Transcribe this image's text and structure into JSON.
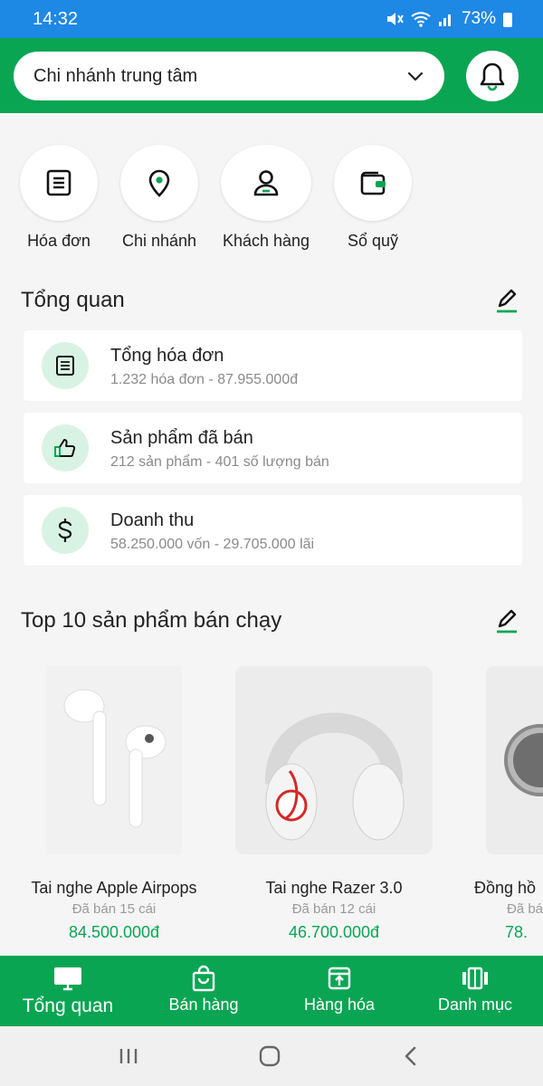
{
  "status_bar": {
    "time": "14:32",
    "battery": "73%"
  },
  "header": {
    "branch": "Chi nhánh trung tâm"
  },
  "quick_actions": [
    {
      "label": "Hóa đơn",
      "icon": "receipt-icon"
    },
    {
      "label": "Chi nhánh",
      "icon": "location-pin-icon"
    },
    {
      "label": "Khách hàng",
      "icon": "user-icon"
    },
    {
      "label": "Sổ quỹ",
      "icon": "wallet-icon"
    }
  ],
  "overview": {
    "title": "Tổng quan",
    "cards": [
      {
        "title": "Tổng hóa đơn",
        "subtitle": "1.232 hóa đơn - 87.955.000đ",
        "icon": "receipt-icon"
      },
      {
        "title": "Sản phẩm đã bán",
        "subtitle": "212 sản phẩm - 401 số lượng bán",
        "icon": "thumbs-up-icon"
      },
      {
        "title": "Doanh thu",
        "subtitle": "58.250.000 vốn - 29.705.000 lãi",
        "icon": "dollar-icon"
      }
    ]
  },
  "top_products": {
    "title": "Top 10 sản phẩm bán chạy",
    "items": [
      {
        "name": "Tai nghe Apple Airpops",
        "sold": "Đã bán 15 cái",
        "price": "84.500.000đ"
      },
      {
        "name": "Tai nghe Razer 3.0",
        "sold": "Đã bán 12 cái",
        "price": "46.700.000đ"
      },
      {
        "name": "Đồng hồ",
        "sold": "Đã bán",
        "price": "78."
      }
    ]
  },
  "bottom_nav": [
    {
      "label": "Tổng quan",
      "icon": "monitor-icon",
      "active": true
    },
    {
      "label": "Bán hàng",
      "icon": "shopping-bag-icon",
      "active": false
    },
    {
      "label": "Hàng hóa",
      "icon": "box-icon",
      "active": false
    },
    {
      "label": "Danh mục",
      "icon": "categories-icon",
      "active": false
    }
  ],
  "colors": {
    "primary": "#0aa553",
    "status_bar": "#1e88e5",
    "icon_bg": "#d8f3e4"
  }
}
